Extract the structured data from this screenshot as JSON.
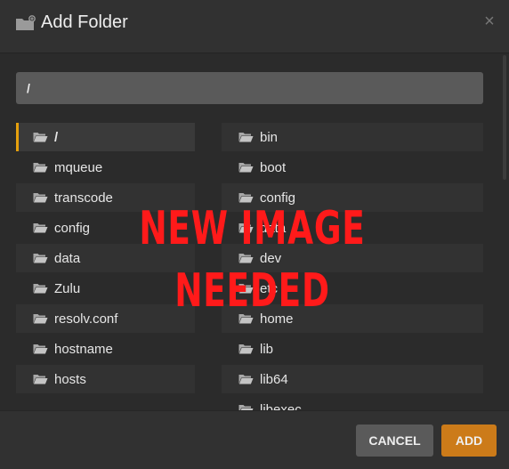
{
  "dialog": {
    "title": "Add Folder",
    "close_glyph": "×",
    "title_icon": "folder-add-icon",
    "accent_color": "#e5a00d",
    "add_color": "#cc7b19"
  },
  "path_input": {
    "value": "/"
  },
  "left_column": [
    {
      "label": "/",
      "selected": true
    },
    {
      "label": "mqueue"
    },
    {
      "label": "transcode"
    },
    {
      "label": "config"
    },
    {
      "label": "data"
    },
    {
      "label": "Zulu"
    },
    {
      "label": "resolv.conf"
    },
    {
      "label": "hostname"
    },
    {
      "label": "hosts"
    }
  ],
  "right_column": [
    {
      "label": "bin"
    },
    {
      "label": "boot"
    },
    {
      "label": "config"
    },
    {
      "label": "data"
    },
    {
      "label": "dev"
    },
    {
      "label": "etc"
    },
    {
      "label": "home"
    },
    {
      "label": "lib"
    },
    {
      "label": "lib64"
    },
    {
      "label": "libexec"
    }
  ],
  "overlay_text": "NEW IMAGE NEEDED",
  "footer": {
    "cancel_label": "CANCEL",
    "add_label": "ADD"
  }
}
